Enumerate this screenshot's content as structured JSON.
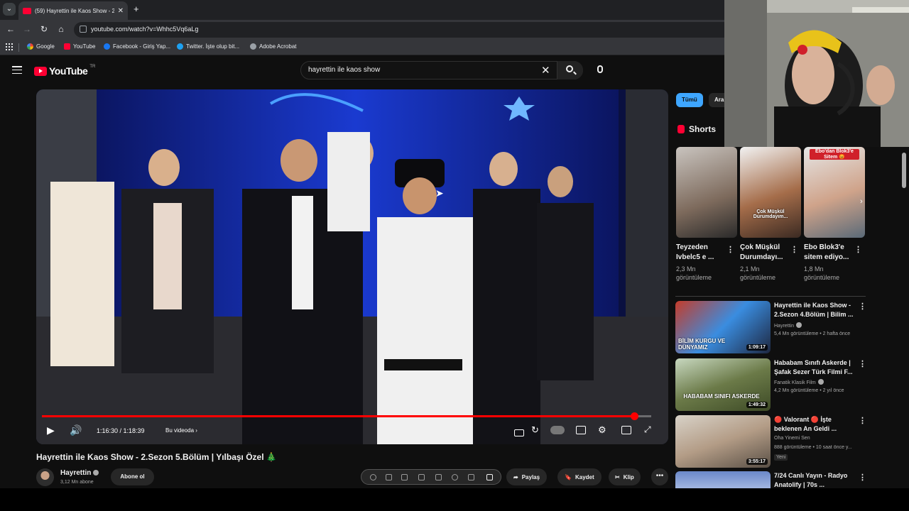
{
  "browser": {
    "tab_title": "(59) Hayrettin ile Kaos Show - 2",
    "url": "youtube.com/watch?v=Whhc5Vq6aLg",
    "bookmarks": [
      "Google",
      "YouTube",
      "Facebook - Giriş Yap...",
      "Twitter. İşte olup bit...",
      "Adobe Acrobat"
    ]
  },
  "youtube": {
    "logo_text": "YouTube",
    "country_code": "TR",
    "search_query": "hayrettin ile kaos show"
  },
  "player": {
    "time": "1:16:30 / 1:18:39",
    "chapter": "Bu videoda",
    "progress_fraction": 0.972
  },
  "video": {
    "title": "Hayrettin ile Kaos Show - 2.Sezon 5.Bölüm | Yılbaşı Özel 🎄",
    "channel": "Hayrettin",
    "subscribers": "3,12 Mn abone",
    "subscribe_label": "Abone ol",
    "share_label": "Paylaş",
    "save_label": "Kaydet",
    "clip_label": "Klip"
  },
  "sidebar": {
    "chips": [
      "Tümü",
      "Ara"
    ],
    "shorts_heading": "Shorts",
    "shorts": [
      {
        "title": "Teyzeden Ivbelc5 e ...",
        "views": "2,3 Mn görüntüleme"
      },
      {
        "title": "Çok Müşkül Durumdayı...",
        "views": "2,1 Mn görüntüleme",
        "overlay": "Çok Müşkül Durumdayım..."
      },
      {
        "title": "Ebo Blok3'e sitem ediyo...",
        "views": "1,8 Mn görüntüleme",
        "overlay": "Ebo'dan Blok3'e Sitem 😡"
      }
    ],
    "recommendations": [
      {
        "title": "Hayrettin ile Kaos Show - 2.Sezon 4.Bölüm | Bilim ...",
        "channel": "Hayrettin",
        "meta": "5,4 Mn görüntüleme • 2 hafta önce",
        "duration": "1:09:17",
        "thumb_text": "BİLİM KURGU VE DÜNYAMIZ"
      },
      {
        "title": "Hababam Sınıfı Askerde | Şafak Sezer Türk Filmi F...",
        "channel": "Fanatik Klasik Film",
        "meta": "4,2 Mn görüntüleme • 2 yıl önce",
        "duration": "1:49:32",
        "thumb_text": "HABABAM SINIFI ASKERDE"
      },
      {
        "title": "🔴 Valorant 🔴 İşte beklenen An Geldi ...",
        "channel": "Oha Yinemi Sen",
        "meta": "888 görüntüleme • 10 saat önce y...",
        "duration": "3:55:17",
        "badge": "Yeni"
      },
      {
        "title": "7/24 Canlı Yayın - Radyo Anatolify | 70s ...",
        "channel": "",
        "meta": "",
        "duration": ""
      }
    ]
  },
  "colors": {
    "accent": "#ff0000",
    "background": "#0f0f0f",
    "chip_active": "#3ea6ff"
  }
}
